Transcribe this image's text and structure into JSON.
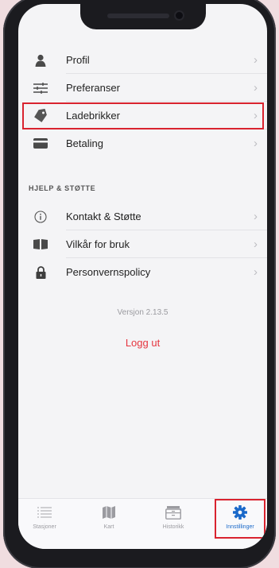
{
  "menu": {
    "items": [
      {
        "label": "Profil",
        "icon": "person-icon"
      },
      {
        "label": "Preferanser",
        "icon": "sliders-icon"
      },
      {
        "label": "Ladebrikker",
        "icon": "tag-icon"
      },
      {
        "label": "Betaling",
        "icon": "credit-card-icon"
      }
    ]
  },
  "help": {
    "title": "HJELP & STØTTE",
    "items": [
      {
        "label": "Kontakt & Støtte",
        "icon": "info-icon"
      },
      {
        "label": "Vilkår for bruk",
        "icon": "book-icon"
      },
      {
        "label": "Personvernspolicy",
        "icon": "lock-icon"
      }
    ]
  },
  "version": "Versjon 2.13.5",
  "logout": "Logg ut",
  "chevron": "›",
  "tabs": [
    {
      "label": "Stasjoner",
      "icon": "list-icon"
    },
    {
      "label": "Kart",
      "icon": "map-icon"
    },
    {
      "label": "Historikk",
      "icon": "archive-icon"
    },
    {
      "label": "Innstillinger",
      "icon": "gear-icon"
    }
  ],
  "colors": {
    "highlight": "#d9232f",
    "accent": "#1a69c9",
    "logout": "#e5353f"
  }
}
